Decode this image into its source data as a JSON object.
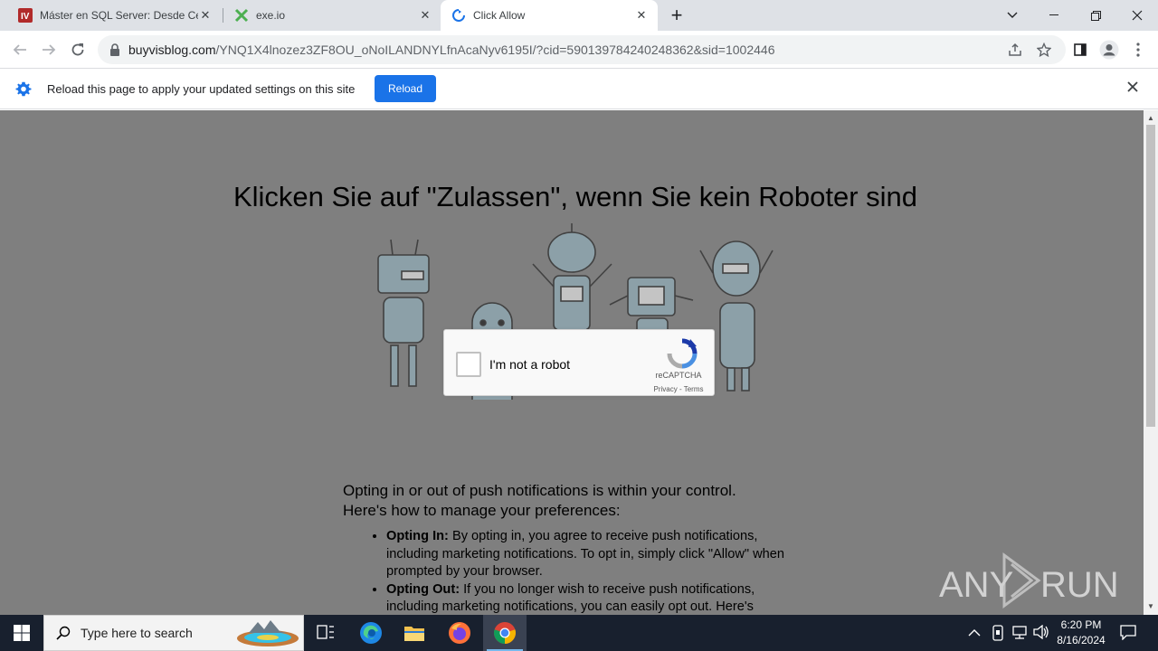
{
  "browser": {
    "tabs": [
      {
        "title": "Máster en SQL Server: Desde Cer",
        "favicon": "udemy-favicon-icon",
        "active": false
      },
      {
        "title": "exe.io",
        "favicon": "exeio-favicon-icon",
        "active": false
      },
      {
        "title": "Click Allow",
        "favicon": "loading-favicon-icon",
        "active": true
      }
    ],
    "new_tab_label": "+",
    "url_host": "buyvisblog.com",
    "url_path": "/YNQ1X4lnozez3ZF8OU_oNoILANDNYLfnAcaNyv6195I/?cid=590139784240248362&sid=1002446",
    "accent": "#1a73e8"
  },
  "infobar": {
    "message": "Reload this page to apply your updated settings on this site",
    "button_label": "Reload"
  },
  "page": {
    "headline": "Klicken Sie auf \"Zulassen\", wenn Sie kein Roboter sind",
    "captcha": {
      "label": "I'm not a robot",
      "brand": "reCAPTCHA",
      "links": "Privacy - Terms"
    },
    "info": {
      "lead_line1": "Opting in or out of push notifications is within your control.",
      "lead_line2": "Here's how to manage your preferences:",
      "items": [
        {
          "term": "Opting In:",
          "text": " By opting in, you agree to receive push notifications, including marketing notifications. To opt in, simply click \"Allow\" when prompted by your browser."
        },
        {
          "term": "Opting Out:",
          "text": " If you no longer wish to receive push notifications, including marketing notifications, you can easily opt out. Here's"
        }
      ]
    },
    "watermark": "ANY RUN",
    "background": "#7f7f7f"
  },
  "taskbar": {
    "search_placeholder": "Type here to search",
    "time": "6:20 PM",
    "date": "8/16/2024",
    "pinned": [
      "task-view-icon",
      "edge-icon",
      "file-explorer-icon",
      "firefox-icon",
      "chrome-icon"
    ]
  }
}
